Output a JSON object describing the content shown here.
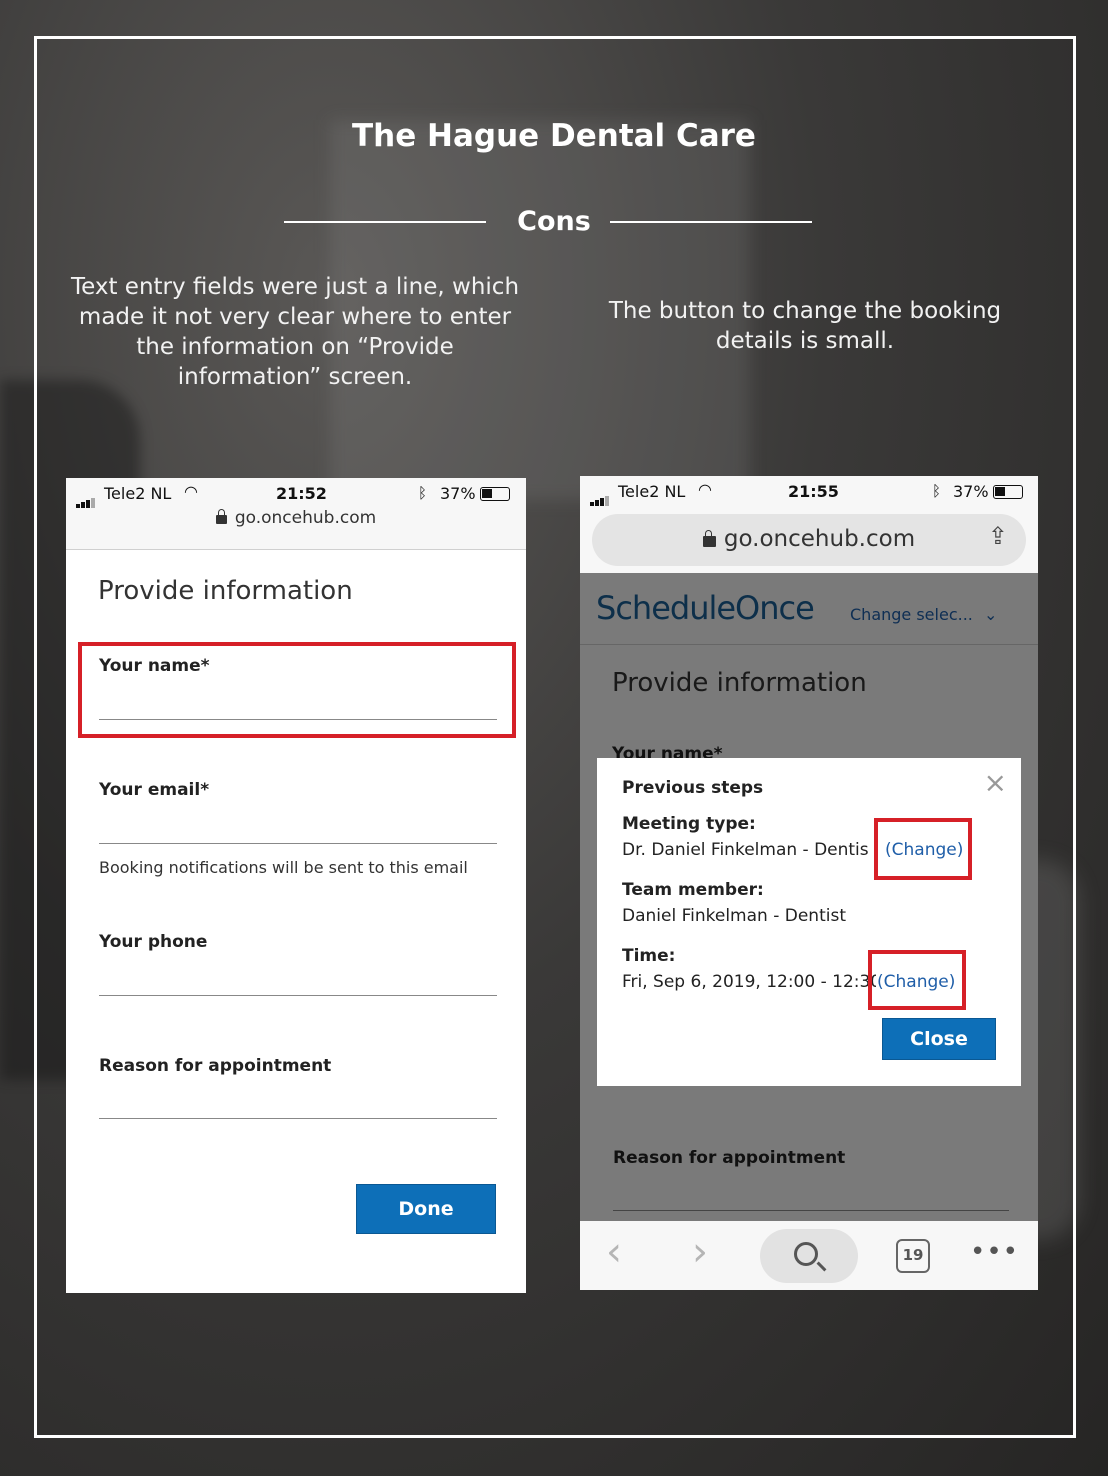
{
  "page": {
    "title": "The Hague Dental Care",
    "section_label": "Cons"
  },
  "notes": {
    "left": "Text entry fields were just a line, which made it not very clear where to enter the information on “Provide information” screen.",
    "right": "The button to change the booking details is small."
  },
  "left_phone": {
    "status": {
      "carrier": "Tele2 NL",
      "time": "21:52",
      "battery": "37%"
    },
    "url": "go.oncehub.com",
    "heading": "Provide information",
    "fields": [
      {
        "label": "Your name*"
      },
      {
        "label": "Your email*",
        "hint": "Booking notifications will be sent to this email"
      },
      {
        "label": "Your phone"
      },
      {
        "label": "Reason for appointment"
      }
    ],
    "done_label": "Done"
  },
  "right_phone": {
    "status": {
      "carrier": "Tele2 NL",
      "time": "21:55",
      "battery": "37%"
    },
    "url": "go.oncehub.com",
    "brand": "ScheduleOnce",
    "change_selection": "Change selec...",
    "heading": "Provide information",
    "partial_field_label": "Your name*",
    "bottom_field_label": "Reason for appointment",
    "tab_count": "19",
    "modal": {
      "title": "Previous steps",
      "close_x": "×",
      "meeting_type_label": "Meeting type:",
      "meeting_type_value": "Dr. Daniel Finkelman - Dentis",
      "team_member_label": "Team member:",
      "team_member_value": "Daniel Finkelman - Dentist",
      "time_label": "Time:",
      "time_value": "Fri, Sep 6, 2019, 12:00 - 12:30",
      "change_label": "(Change)",
      "close_label": "Close"
    }
  },
  "colors": {
    "highlight_red": "#d62027",
    "button_blue": "#0d6fb8",
    "link_blue": "#1f5ea8"
  }
}
